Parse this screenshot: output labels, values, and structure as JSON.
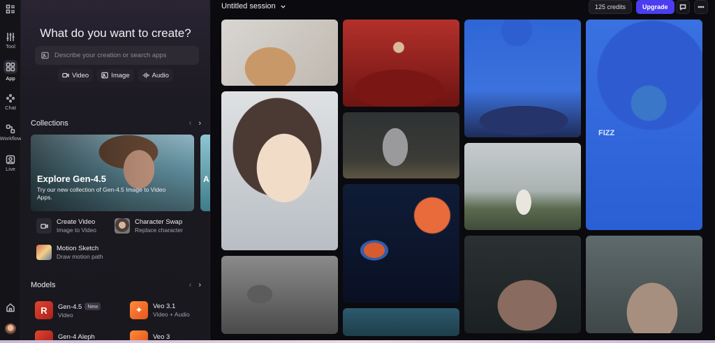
{
  "rail": {
    "items": [
      {
        "label": "Tool",
        "icon": "sliders-icon"
      },
      {
        "label": "App",
        "icon": "grid-icon"
      },
      {
        "label": "Chat",
        "icon": "chat-icon"
      },
      {
        "label": "Workflow",
        "icon": "workflow-icon"
      },
      {
        "label": "Live",
        "icon": "live-icon"
      }
    ]
  },
  "panel": {
    "heading": "What do you want to create?",
    "search_placeholder": "Describe your creation or search apps",
    "modes": [
      "Video",
      "Image",
      "Audio"
    ],
    "collections": {
      "title": "Collections",
      "feature_title": "Explore Gen-4.5",
      "feature_desc": "Try our new collection of Gen-4.5 Image to Video Apps.",
      "peek_letter": "A",
      "peek_text": "C a"
    },
    "apps": [
      {
        "name": "Create Video",
        "sub": "Image to Video"
      },
      {
        "name": "Character Swap",
        "sub": "Replace character"
      },
      {
        "name": "Motion Sketch",
        "sub": "Draw motion path"
      }
    ],
    "models": {
      "title": "Models",
      "items": [
        {
          "name": "Gen-4.5",
          "badge": "New",
          "sub": "Video"
        },
        {
          "name": "Veo 3.1",
          "sub": "Video + Audio"
        },
        {
          "name": "Gen-4 Aleph",
          "sub": ""
        },
        {
          "name": "Veo 3",
          "sub": ""
        }
      ]
    }
  },
  "header": {
    "session": "Untitled session",
    "credits": "125 credits",
    "upgrade": "Upgrade"
  },
  "gallery": {
    "watermark": "FIZZ"
  },
  "colors": {
    "accent": "#4a3ef0",
    "model_red": "#e2452f",
    "model_orange": "#ff8a3c"
  }
}
